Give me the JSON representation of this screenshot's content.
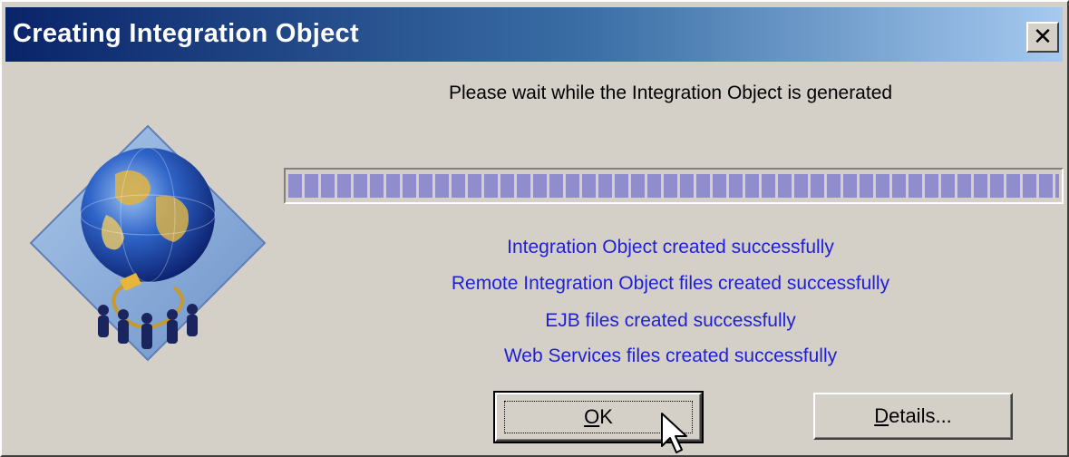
{
  "dialog": {
    "title": "Creating Integration Object",
    "close_glyph": "✕",
    "message": "Please wait while the Integration Object is generated",
    "progress": {
      "fraction": 1.0
    },
    "statuses": [
      "Integration Object created successfully",
      "Remote Integration Object files created successfully",
      "EJB files created successfully",
      "Web Services files created successfully"
    ],
    "buttons": {
      "ok": {
        "label": "OK",
        "mnemonic": "O"
      },
      "details": {
        "label": "Details...",
        "mnemonic": "D"
      }
    }
  },
  "colors": {
    "title_gradient_start": "#0a246a",
    "title_gradient_end": "#a6caf0",
    "status_text": "#1f1fd6",
    "progress_block": "#8f8dce",
    "face": "#d4d0c8"
  },
  "icons": {
    "logo": "globe-diamond-icon",
    "close": "close-icon",
    "cursor": "mouse-pointer-icon"
  }
}
